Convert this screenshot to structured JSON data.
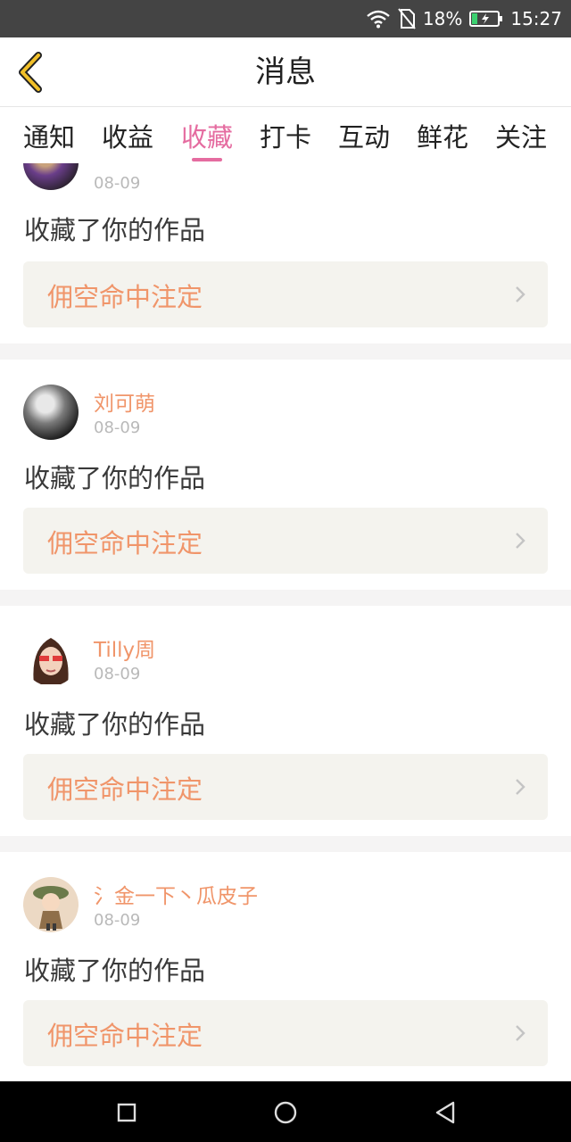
{
  "status_bar": {
    "battery": "18%",
    "time": "15:27",
    "icons": [
      "wifi-icon",
      "no-sim-icon",
      "battery-charging-icon"
    ]
  },
  "header": {
    "title": "消息",
    "back_icon": "chevron-left-icon",
    "accent_color": "#f2c029"
  },
  "tabs": [
    {
      "label": "通知",
      "active": false
    },
    {
      "label": "收益",
      "active": false
    },
    {
      "label": "收藏",
      "active": true
    },
    {
      "label": "打卡",
      "active": false
    },
    {
      "label": "互动",
      "active": false
    },
    {
      "label": "鲜花",
      "active": false
    },
    {
      "label": "关注",
      "active": false
    }
  ],
  "active_color": "#e56ca0",
  "items": [
    {
      "name": "",
      "date": "08-09",
      "action": "收藏了你的作品",
      "work_title": "佣空命中注定"
    },
    {
      "name": "刘可萌",
      "date": "08-09",
      "action": "收藏了你的作品",
      "work_title": "佣空命中注定"
    },
    {
      "name": "Tilly周",
      "date": "08-09",
      "action": "收藏了你的作品",
      "work_title": "佣空命中注定"
    },
    {
      "name": "氵金一下丶瓜皮子",
      "date": "08-09",
      "action": "收藏了你的作品",
      "work_title": "佣空命中注定"
    }
  ],
  "nav_bar": {
    "buttons": [
      "recents-square-icon",
      "home-circle-icon",
      "back-triangle-icon"
    ]
  }
}
